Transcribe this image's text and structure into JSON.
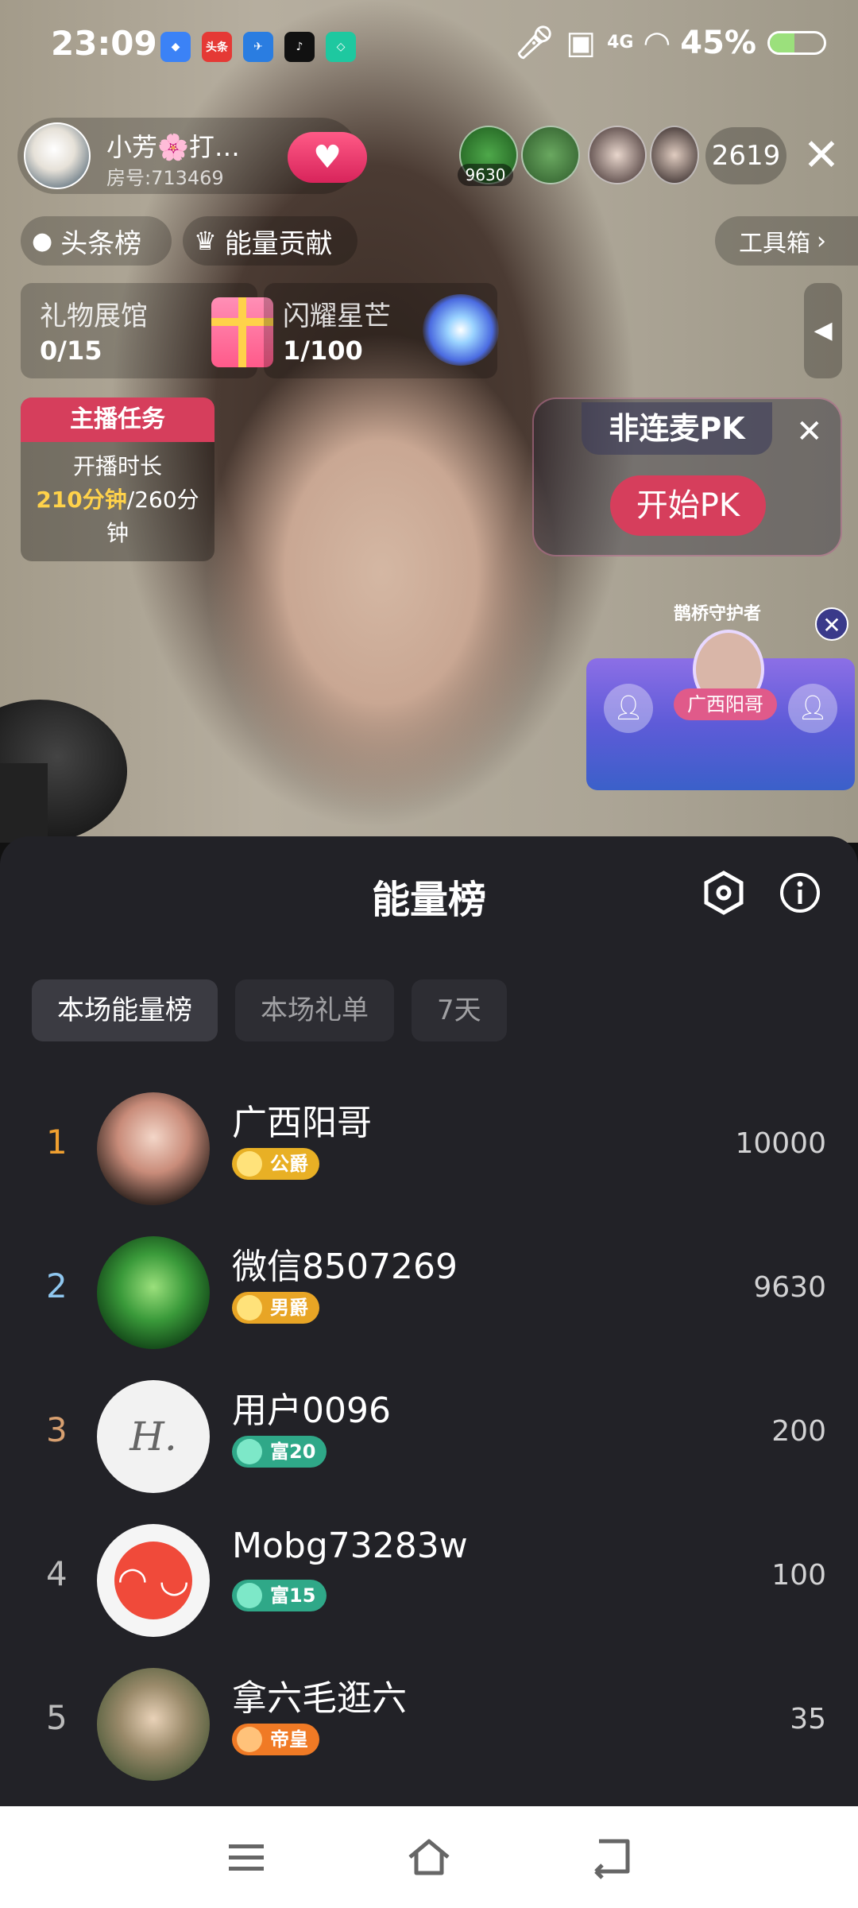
{
  "status_bar": {
    "time": "23:09",
    "battery": "45%",
    "battery_level": 0.45,
    "network": "4G",
    "apps": [
      "头条"
    ]
  },
  "live": {
    "host": {
      "name": "小芳🌸打…",
      "room": "房号:713469"
    },
    "viewer_badge": "9630",
    "viewer_count": "2619",
    "row2": {
      "headline_rank": "头条榜",
      "energy_contribution": "能量贡献",
      "toolbox": "工具箱"
    },
    "gallery": {
      "title": "礼物展馆",
      "value": "0/15"
    },
    "stars": {
      "title": "闪耀星芒",
      "value": "1/100"
    },
    "task": {
      "title": "主播任务",
      "label": "开播时长",
      "progress": "210分钟",
      "total": "/260分钟"
    },
    "pk": {
      "title": "非连麦PK",
      "button": "开始PK"
    },
    "guard": {
      "label": "鹊桥守护者",
      "name": "广西阳哥"
    }
  },
  "sheet": {
    "title": "能量榜",
    "tabs": [
      {
        "label": "本场能量榜",
        "active": true
      },
      {
        "label": "本场礼单",
        "active": false
      },
      {
        "label": "7天",
        "active": false
      }
    ],
    "ranks": [
      {
        "rank": "1",
        "name": "广西阳哥",
        "badge": "公爵",
        "score": "10000",
        "rank_color": "#f0a030",
        "badge_color": "#e8b025"
      },
      {
        "rank": "2",
        "name": "微信8507269",
        "badge": "男爵",
        "score": "9630",
        "rank_color": "#8fc7ef",
        "badge_color": "#e8a525"
      },
      {
        "rank": "3",
        "name": "用户0096",
        "badge": "富20",
        "score": "200",
        "rank_color": "#d8a070",
        "badge_color": "#2fa888"
      },
      {
        "rank": "4",
        "name": "Mobg73283w",
        "badge": "富15",
        "score": "100",
        "rank_color": "#bbbbbb",
        "badge_color": "#2fa888"
      },
      {
        "rank": "5",
        "name": "拿六毛逛六",
        "badge": "帝皇",
        "score": "35",
        "rank_color": "#bbbbbb",
        "badge_color": "#f07a25"
      }
    ]
  },
  "nav": {
    "icons": [
      "menu-icon",
      "home-icon",
      "back-icon"
    ]
  }
}
